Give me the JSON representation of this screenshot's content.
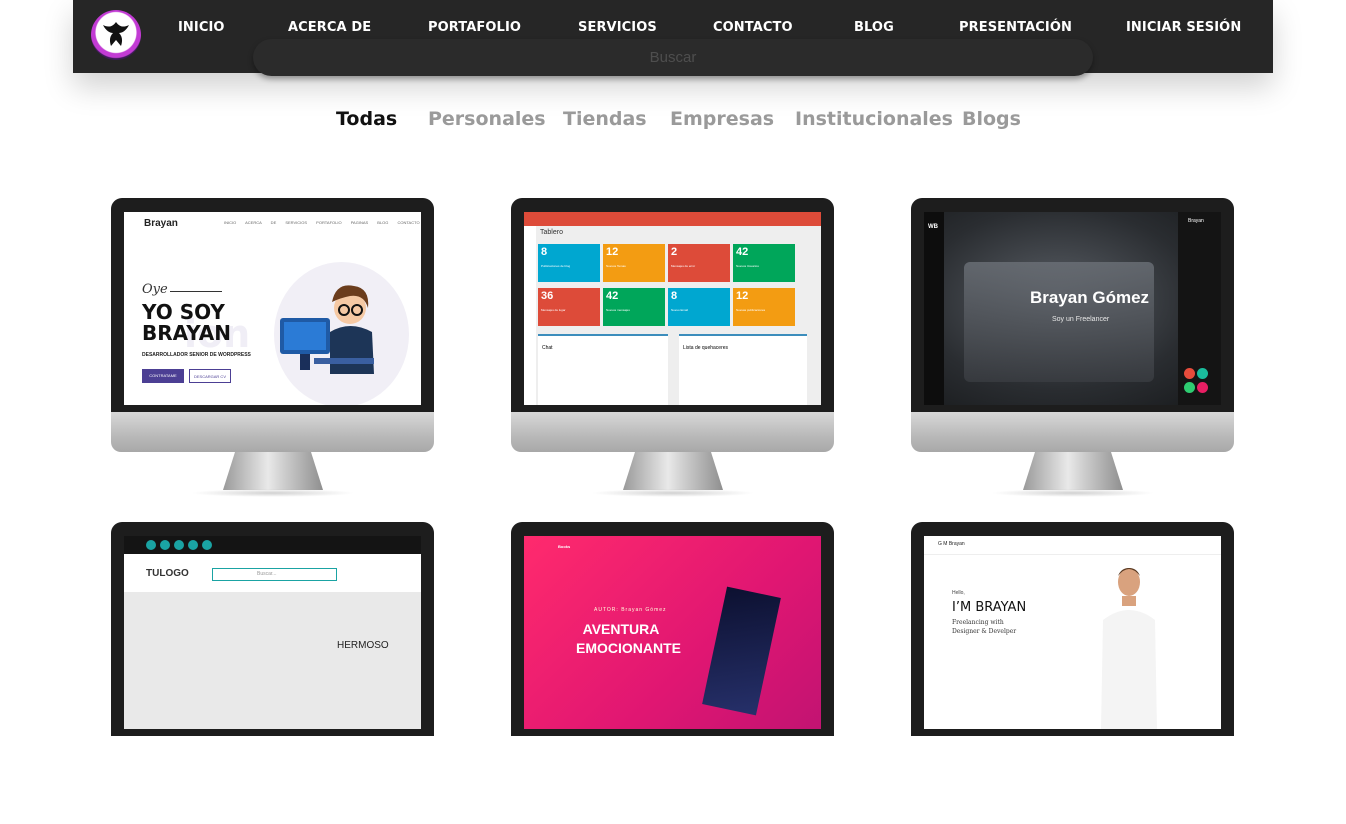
{
  "nav": {
    "items": [
      "INICIO",
      "ACERCA DE",
      "PORTAFOLIO",
      "SERVICIOS",
      "CONTACTO",
      "BLOG",
      "PRESENTACIÓN",
      "INICIAR SESIÓN"
    ],
    "search_placeholder": "Buscar"
  },
  "filters": {
    "active": "Todas",
    "items": [
      "Todas",
      "Personales",
      "Tiendas",
      "Empresas",
      "Institucionales",
      "Blogs"
    ]
  },
  "colors": {
    "navbar": "#262626",
    "accent_red": "#dd4b39",
    "magenta": "#e01672"
  },
  "portfolio": {
    "p1": {
      "brand": "Brayan",
      "menu": "INICIO ACERCA DE SERVICIOS PORTAFOLIO PAGINAS BLOG CONTACTO",
      "greeting": "Oye",
      "headline": "YO SOY BRAYAN",
      "ghost": "ion",
      "subtitle": "DESARROLLADOR SENIOR DE WORDPRESS",
      "btn_primary": "CONTRATAME",
      "btn_secondary": "DESCARGAR CV"
    },
    "p2": {
      "title": "Tablero",
      "tiles": [
        {
          "n": "8",
          "t": "Publicaciones de blog",
          "c": "#00a7d0"
        },
        {
          "n": "12",
          "t": "Nuevos Temas",
          "c": "#f39c12"
        },
        {
          "n": "2",
          "t": "Mensajes de error",
          "c": "#dd4b39"
        },
        {
          "n": "42",
          "t": "Nuevos Usuarios",
          "c": "#00a65a"
        },
        {
          "n": "36",
          "t": "Mensajes de lugar",
          "c": "#dd4b39"
        },
        {
          "n": "42",
          "t": "Nuevos mensajes",
          "c": "#00a65a"
        },
        {
          "n": "8",
          "t": "Nuevo Email",
          "c": "#00a7d0"
        },
        {
          "n": "12",
          "t": "Nuevas publicaciones",
          "c": "#f39c12"
        }
      ],
      "panel_left": "Chat",
      "panel_right": "Lista de quehaceres"
    },
    "p3": {
      "initials": "WB",
      "name": "Brayan Gómez",
      "tagline": "Soy un Freelancer",
      "side_title": "Brayan"
    },
    "p4": {
      "logo": "TULOGO",
      "search_placeholder": "Buscar...",
      "hero_word": "HERMOSO"
    },
    "p5": {
      "brand": "Books",
      "author": "AUTOR: Brayan Gómez",
      "title": "AVENTURA EMOCIONANTE"
    },
    "p6": {
      "brand": "G M Brayan",
      "hello": "Hello,",
      "headline": "I’M BRAYAN",
      "role": "Freelancing with Designer & Develper"
    }
  }
}
